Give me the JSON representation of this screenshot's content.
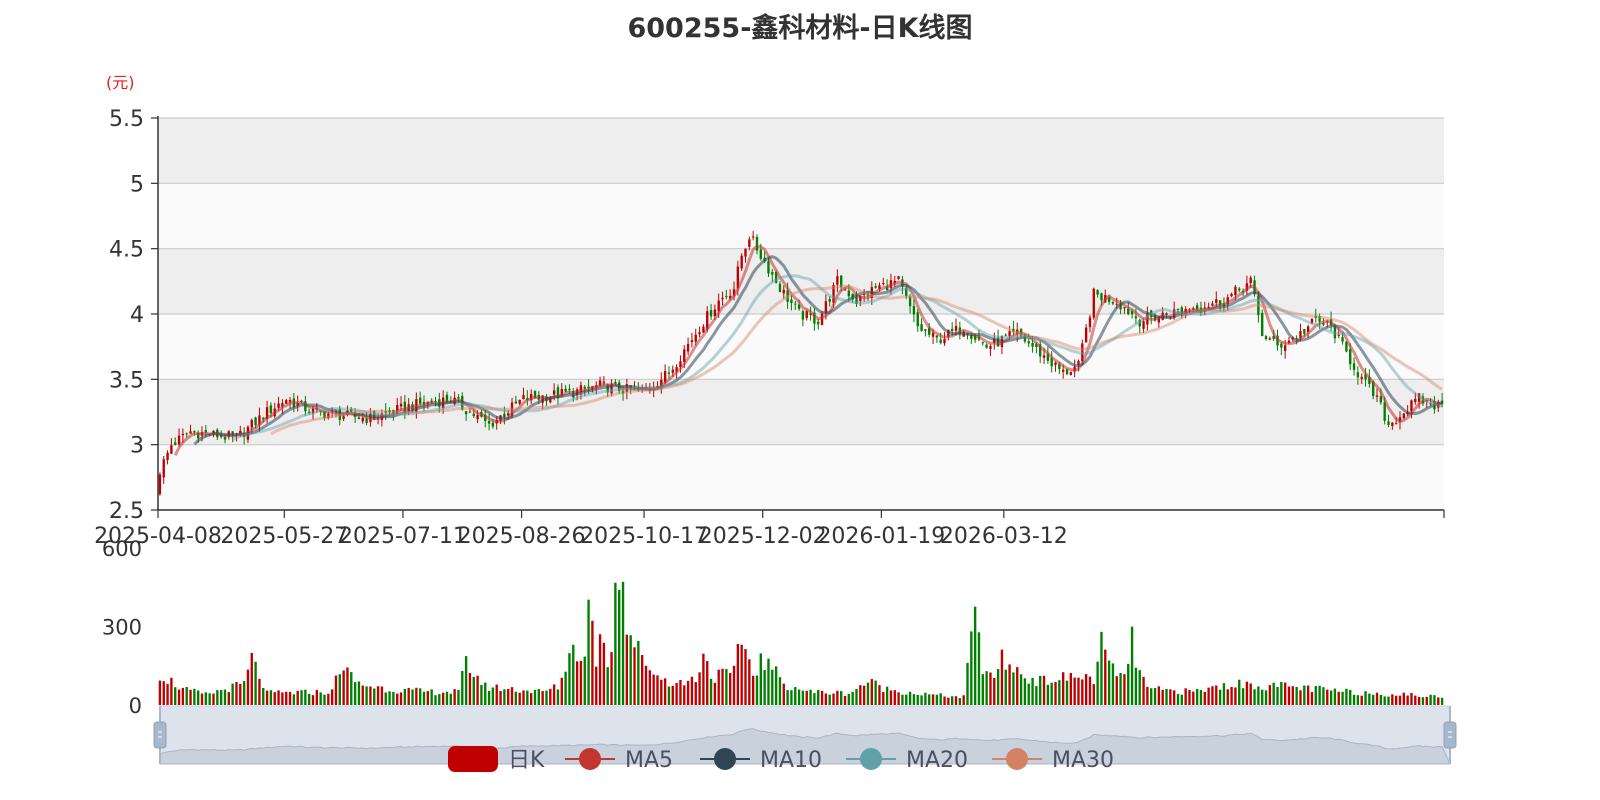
{
  "chart_data": {
    "type": "candlestick",
    "title": "600255-鑫科材料-日K线图",
    "y_unit": "(元)",
    "ylim": [
      2.5,
      5.5
    ],
    "y_ticks": [
      "2.5",
      "3",
      "3.5",
      "4",
      "4.5",
      "5",
      "5.5"
    ],
    "x_tick_labels": [
      "2025-04-08",
      "2025-05-27",
      "2025-07-11",
      "2025-08-26",
      "2025-10-17",
      "2025-12-02",
      "2026-01-19",
      "2026-03-12"
    ],
    "volume_ticks": [
      "0",
      "300",
      "600"
    ],
    "volume_ylim": [
      0,
      600
    ],
    "legend": [
      "日K",
      "MA5",
      "MA10",
      "MA20",
      "MA30"
    ],
    "colors": {
      "up": "#c00000",
      "down": "#008000",
      "ma5": "#c23531",
      "ma10": "#2f4554",
      "ma20": "#61a0a8",
      "ma30": "#d48265"
    },
    "grid": true,
    "legend_position": "bottom-center",
    "price_keypoints": [
      [
        0,
        2.8
      ],
      [
        3,
        3.0
      ],
      [
        8,
        3.1
      ],
      [
        20,
        3.05
      ],
      [
        28,
        3.25
      ],
      [
        33,
        3.35
      ],
      [
        40,
        3.25
      ],
      [
        55,
        3.2
      ],
      [
        66,
        3.3
      ],
      [
        76,
        3.35
      ],
      [
        86,
        3.15
      ],
      [
        95,
        3.35
      ],
      [
        108,
        3.4
      ],
      [
        115,
        3.45
      ],
      [
        126,
        3.4
      ],
      [
        133,
        3.55
      ],
      [
        141,
        3.9
      ],
      [
        146,
        4.1
      ],
      [
        150,
        4.2
      ],
      [
        152,
        4.45
      ],
      [
        154,
        4.6
      ],
      [
        157,
        4.45
      ],
      [
        162,
        4.2
      ],
      [
        167,
        4.0
      ],
      [
        172,
        3.95
      ],
      [
        177,
        4.25
      ],
      [
        182,
        4.1
      ],
      [
        187,
        4.2
      ],
      [
        193,
        4.25
      ],
      [
        198,
        3.9
      ],
      [
        203,
        3.8
      ],
      [
        210,
        3.9
      ],
      [
        216,
        3.75
      ],
      [
        224,
        3.85
      ],
      [
        230,
        3.7
      ],
      [
        236,
        3.55
      ],
      [
        240,
        3.6
      ],
      [
        244,
        4.15
      ],
      [
        250,
        4.1
      ],
      [
        256,
        3.95
      ],
      [
        263,
        4.0
      ],
      [
        270,
        4.05
      ],
      [
        278,
        4.1
      ],
      [
        285,
        4.25
      ],
      [
        288,
        3.85
      ],
      [
        292,
        3.75
      ],
      [
        298,
        3.85
      ],
      [
        302,
        3.95
      ],
      [
        306,
        3.9
      ],
      [
        310,
        3.7
      ],
      [
        314,
        3.5
      ],
      [
        318,
        3.35
      ],
      [
        321,
        3.15
      ],
      [
        325,
        3.25
      ],
      [
        329,
        3.35
      ],
      [
        333,
        3.3
      ],
      [
        335,
        3.3
      ]
    ],
    "volume_keypoints": [
      [
        0,
        120
      ],
      [
        6,
        60
      ],
      [
        12,
        40
      ],
      [
        22,
        80
      ],
      [
        24,
        175
      ],
      [
        28,
        45
      ],
      [
        45,
        50
      ],
      [
        47,
        150
      ],
      [
        52,
        80
      ],
      [
        60,
        60
      ],
      [
        70,
        50
      ],
      [
        78,
        50
      ],
      [
        80,
        160
      ],
      [
        85,
        70
      ],
      [
        100,
        50
      ],
      [
        104,
        70
      ],
      [
        107,
        180
      ],
      [
        108,
        270
      ],
      [
        110,
        150
      ],
      [
        111,
        230
      ],
      [
        112,
        380
      ],
      [
        113,
        300
      ],
      [
        114,
        180
      ],
      [
        116,
        290
      ],
      [
        117,
        160
      ],
      [
        118,
        220
      ],
      [
        119,
        520
      ],
      [
        120,
        550
      ],
      [
        121,
        460
      ],
      [
        122,
        300
      ],
      [
        124,
        240
      ],
      [
        126,
        170
      ],
      [
        128,
        150
      ],
      [
        130,
        110
      ],
      [
        135,
        80
      ],
      [
        140,
        100
      ],
      [
        142,
        205
      ],
      [
        144,
        110
      ],
      [
        150,
        120
      ],
      [
        152,
        260
      ],
      [
        155,
        120
      ],
      [
        157,
        170
      ],
      [
        160,
        140
      ],
      [
        163,
        80
      ],
      [
        170,
        50
      ],
      [
        180,
        45
      ],
      [
        185,
        90
      ],
      [
        190,
        60
      ],
      [
        200,
        40
      ],
      [
        210,
        30
      ],
      [
        212,
        260
      ],
      [
        213,
        310
      ],
      [
        214,
        260
      ],
      [
        215,
        150
      ],
      [
        217,
        100
      ],
      [
        220,
        170
      ],
      [
        223,
        140
      ],
      [
        226,
        110
      ],
      [
        230,
        90
      ],
      [
        240,
        110
      ],
      [
        244,
        100
      ],
      [
        246,
        230
      ],
      [
        248,
        160
      ],
      [
        250,
        100
      ],
      [
        253,
        150
      ],
      [
        254,
        240
      ],
      [
        255,
        170
      ],
      [
        258,
        60
      ],
      [
        270,
        50
      ],
      [
        280,
        80
      ],
      [
        295,
        70
      ],
      [
        310,
        50
      ],
      [
        325,
        40
      ],
      [
        335,
        30
      ]
    ]
  },
  "zoom_handles": [
    "left-handle",
    "right-handle"
  ]
}
